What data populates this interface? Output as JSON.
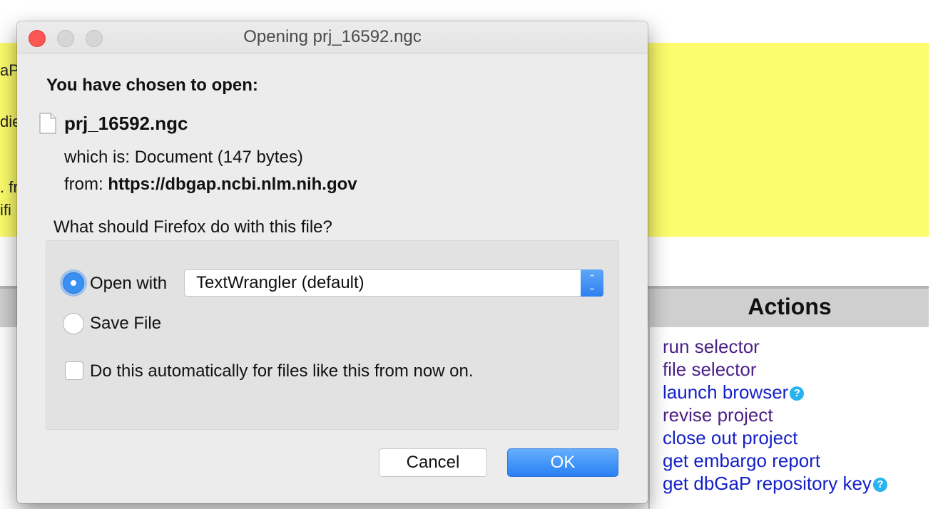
{
  "background": {
    "fragments": [
      "aP",
      "die",
      ". fr",
      "ifi"
    ],
    "actions_title": "Actions",
    "actions": [
      {
        "label": "run selector",
        "visited": true,
        "help": false
      },
      {
        "label": "file selector",
        "visited": true,
        "help": false
      },
      {
        "label": "launch browser",
        "visited": false,
        "help": true
      },
      {
        "label": "revise project",
        "visited": true,
        "help": false
      },
      {
        "label": "close out project",
        "visited": false,
        "help": false
      },
      {
        "label": "get embargo report",
        "visited": false,
        "help": false
      },
      {
        "label": "get dbGaP repository key",
        "visited": false,
        "help": true
      }
    ],
    "help_glyph": "?",
    "colors": {
      "yellow_band": "#fcfc6c",
      "visited_link": "#4b1f86",
      "link": "#1420c8"
    }
  },
  "dialog": {
    "title": "Opening prj_16592.ngc",
    "heading": "You have chosen to open:",
    "file_icon": "document-icon",
    "file_name": "prj_16592.ngc",
    "which_is_label": "which is:",
    "which_is_value": "Document (147 bytes)",
    "from_label": "from:",
    "from_value": "https://dbgap.ncbi.nlm.nih.gov",
    "question": "What should Firefox do with this file?",
    "open_with_label": "Open with",
    "open_with_selected": true,
    "application": "TextWrangler (default)",
    "save_file_label": "Save File",
    "save_file_selected": false,
    "auto_label": "Do this automatically for files like this from now on.",
    "auto_checked": false,
    "cancel_label": "Cancel",
    "ok_label": "OK"
  }
}
